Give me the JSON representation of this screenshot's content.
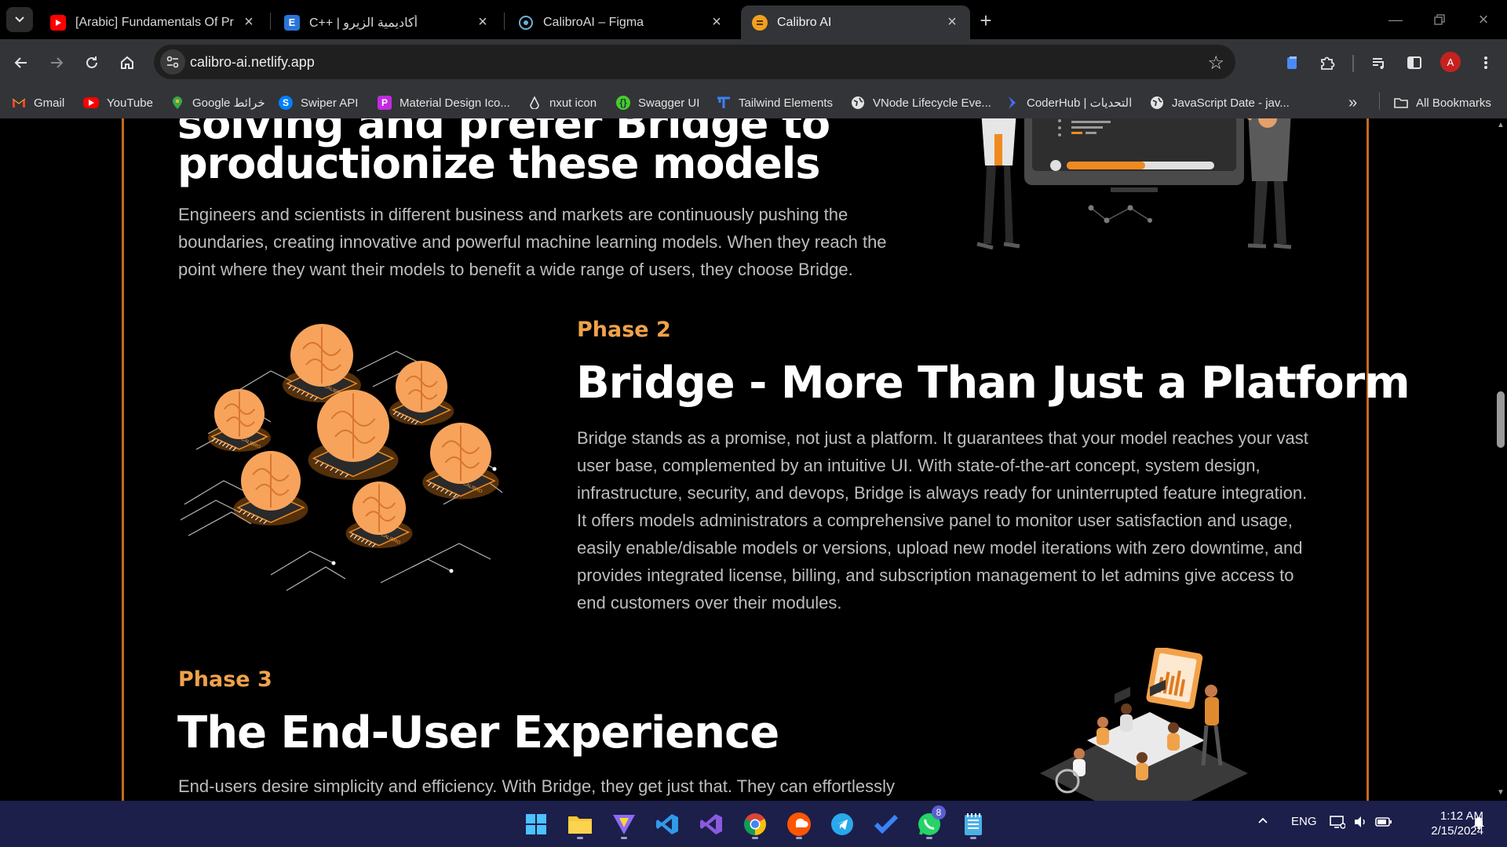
{
  "browser": {
    "tabs": [
      {
        "title": "[Arabic] Fundamentals Of Progr",
        "favicon": "youtube-icon",
        "favicon_color": "#ff0000",
        "active": false
      },
      {
        "title": "C++ | أكاديمية الزيرو",
        "favicon": "e-letter-icon",
        "favicon_color": "#2a74d9",
        "active": false
      },
      {
        "title": "CalibroAI – Figma",
        "favicon": "figma-icon",
        "favicon_color": "#5aa0c8",
        "active": false
      },
      {
        "title": "Calibro AI",
        "favicon": "calibro-icon",
        "favicon_color": "#f0a020",
        "active": true
      }
    ],
    "url": "calibro-ai.netlify.app",
    "profile_initial": "A",
    "bookmarks": [
      {
        "label": "Gmail",
        "icon": "gmail-icon"
      },
      {
        "label": "YouTube",
        "icon": "youtube-icon"
      },
      {
        "label": "Google خرائط",
        "icon": "maps-pin-icon"
      },
      {
        "label": "Swiper API",
        "icon": "swiper-icon"
      },
      {
        "label": "Material Design Ico...",
        "icon": "material-icon"
      },
      {
        "label": "nxut icon",
        "icon": "nuxt-icon"
      },
      {
        "label": "Swagger UI",
        "icon": "swagger-icon"
      },
      {
        "label": "Tailwind Elements",
        "icon": "tailwind-icon"
      },
      {
        "label": "VNode Lifecycle Eve...",
        "icon": "globe-icon"
      },
      {
        "label": "CoderHub | التحديات",
        "icon": "coderhub-icon"
      },
      {
        "label": "JavaScript Date - jav...",
        "icon": "globe-icon"
      }
    ],
    "all_bookmarks_label": "All Bookmarks"
  },
  "page": {
    "phase1": {
      "heading_line1": "solving and prefer Bridge to",
      "heading_line2": "productionize these models",
      "paragraph": "Engineers and scientists in different business and markets are continuously pushing the boundaries, creating innovative and powerful machine learning models. When they reach the point where they want their models to benefit a wide range of users, they choose Bridge."
    },
    "phase2": {
      "label": "Phase 2",
      "heading": "Bridge - More Than Just a Platform",
      "paragraph": "Bridge stands as a promise, not just a platform. It guarantees that your model reaches your vast user base, complemented by an intuitive UI. With state-of-the-art concept, system design, infrastructure, security, and devops, Bridge is always ready for uninterrupted feature integration. It offers models administrators a comprehensive panel to monitor user satisfaction and usage, easily enable/disable models or versions, upload new model iterations with zero downtime, and provides integrated license, billing, and subscription management to let admins give access to end customers over their modules."
    },
    "phase3": {
      "label": "Phase 3",
      "heading": "The End-User Experience",
      "paragraph": "End-users desire simplicity and efficiency. With Bridge, they get just that. They can effortlessly"
    },
    "chip_label": "CALIBRO",
    "accent_color": "#f0a24a",
    "frame_color": "#c46a20"
  },
  "taskbar": {
    "apps": [
      "windows-start-icon",
      "file-explorer-icon",
      "vite-icon",
      "vscode-icon",
      "visual-studio-icon",
      "chrome-icon",
      "soundcloud-icon",
      "telegram-icon",
      "todo-icon",
      "whatsapp-icon",
      "notepad-icon"
    ],
    "whatsapp_badge": "8",
    "language": "ENG",
    "time": "1:12 AM",
    "date": "2/15/2024"
  }
}
